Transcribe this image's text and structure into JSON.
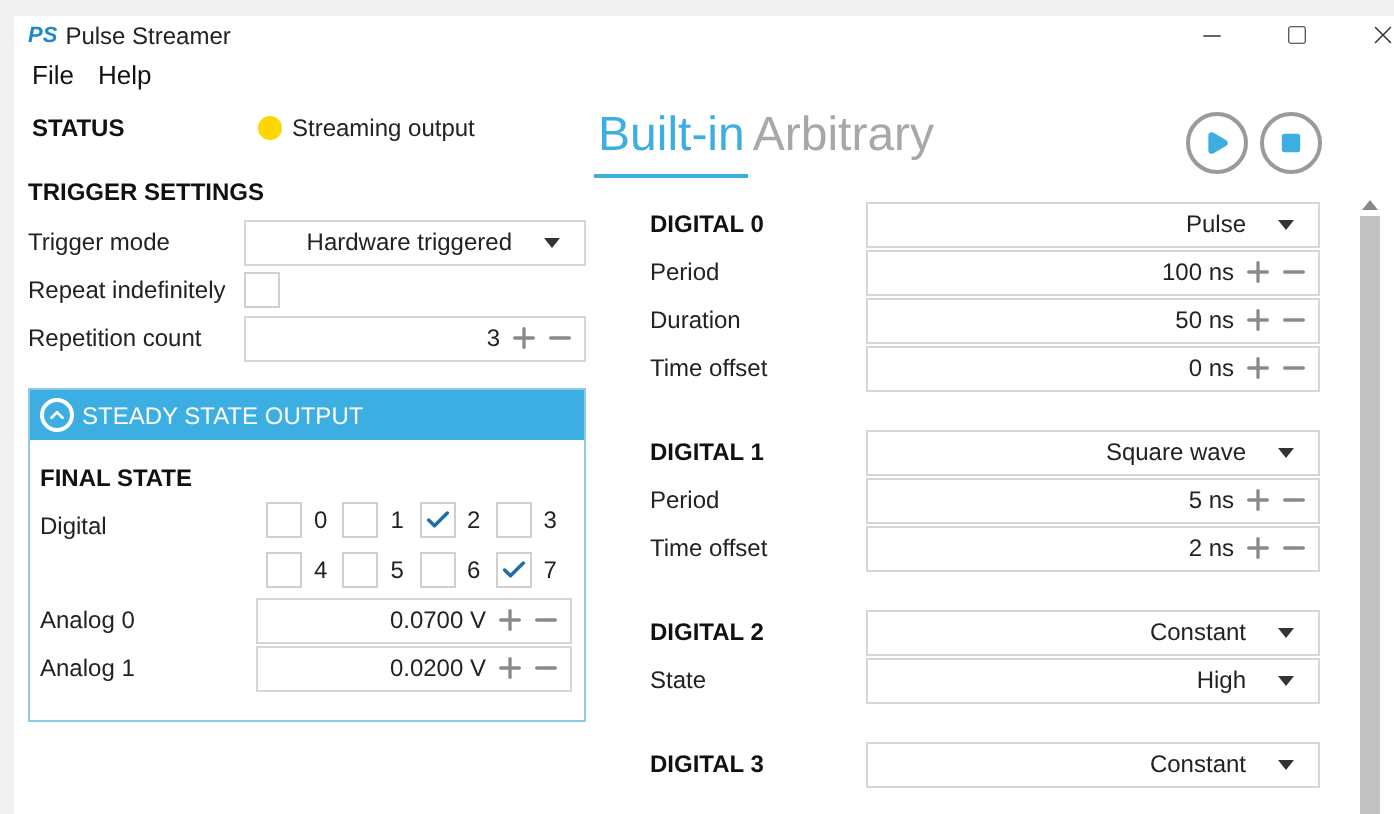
{
  "window": {
    "title": "Pulse Streamer",
    "logo": "PS"
  },
  "menu": [
    "File",
    "Help"
  ],
  "status": {
    "label": "STATUS",
    "text": "Streaming output",
    "color": "#ffd700"
  },
  "trigger_settings": {
    "title": "TRIGGER SETTINGS",
    "rows": [
      {
        "kind": "dropdown",
        "label": "Trigger mode",
        "value": "Hardware triggered"
      },
      {
        "kind": "checkbox",
        "label": "Repeat indefinitely",
        "checked": false
      },
      {
        "kind": "spinner",
        "label": "Repetition count",
        "value": "3"
      }
    ]
  },
  "steady_state": {
    "title": "STEADY STATE OUTPUT",
    "expanded": true,
    "final_state": "FINAL STATE",
    "digital_label": "Digital",
    "digital": [
      {
        "label": "0",
        "checked": false
      },
      {
        "label": "1",
        "checked": false
      },
      {
        "label": "2",
        "checked": true
      },
      {
        "label": "3",
        "checked": false
      },
      {
        "label": "4",
        "checked": false
      },
      {
        "label": "5",
        "checked": false
      },
      {
        "label": "6",
        "checked": false
      },
      {
        "label": "7",
        "checked": true
      }
    ],
    "analog": [
      {
        "label": "Analog 0",
        "value": "0.0700 V"
      },
      {
        "label": "Analog 1",
        "value": "0.0200 V"
      }
    ]
  },
  "tabs": [
    {
      "label": "Built-in",
      "selected": true
    },
    {
      "label": "Arbitrary",
      "selected": false
    }
  ],
  "channels": [
    {
      "name": "DIGITAL 0",
      "mode": "Pulse",
      "params": [
        {
          "kind": "spinner",
          "label": "Period",
          "value": "100 ns"
        },
        {
          "kind": "spinner",
          "label": "Duration",
          "value": "50 ns"
        },
        {
          "kind": "spinner",
          "label": "Time offset",
          "value": "0 ns"
        }
      ]
    },
    {
      "name": "DIGITAL 1",
      "mode": "Square wave",
      "params": [
        {
          "kind": "spinner",
          "label": "Period",
          "value": "5 ns"
        },
        {
          "kind": "spinner",
          "label": "Time offset",
          "value": "2 ns"
        }
      ]
    },
    {
      "name": "DIGITAL 2",
      "mode": "Constant",
      "params": [
        {
          "kind": "dropdown",
          "label": "State",
          "value": "High"
        }
      ]
    },
    {
      "name": "DIGITAL 3",
      "mode": "Constant"
    }
  ]
}
